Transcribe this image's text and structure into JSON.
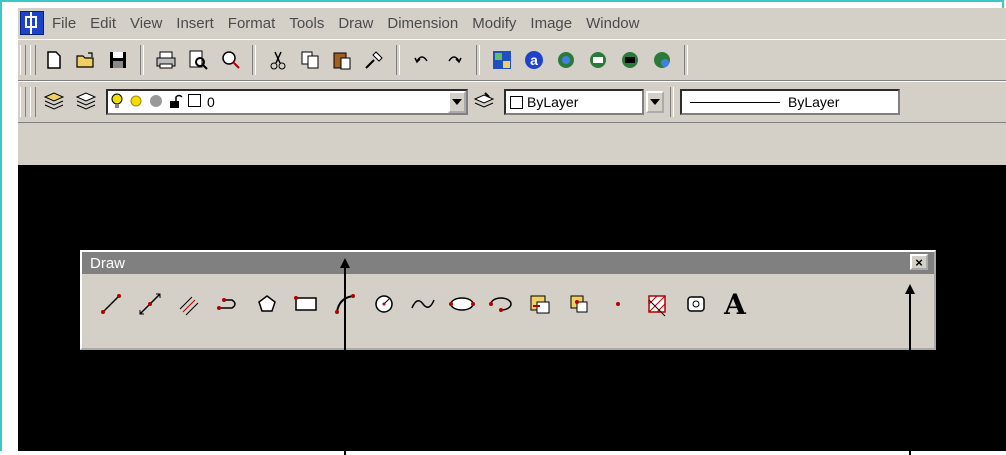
{
  "menu": {
    "items": [
      "File",
      "Edit",
      "View",
      "Insert",
      "Format",
      "Tools",
      "Draw",
      "Dimension",
      "Modify",
      "Image",
      "Window"
    ]
  },
  "layers": {
    "current_layer": "0",
    "color_value": "ByLayer",
    "linetype_value": "ByLayer"
  },
  "draw_toolbar": {
    "title": "Draw",
    "close_glyph": "×",
    "text_tool_glyph": "A"
  },
  "colors": {
    "canvas": "#000000",
    "window_bg": "#d4d0c8",
    "title_bar": "#808080",
    "frame_accent": "#3cc7c7",
    "tool_red": "#b00000"
  }
}
